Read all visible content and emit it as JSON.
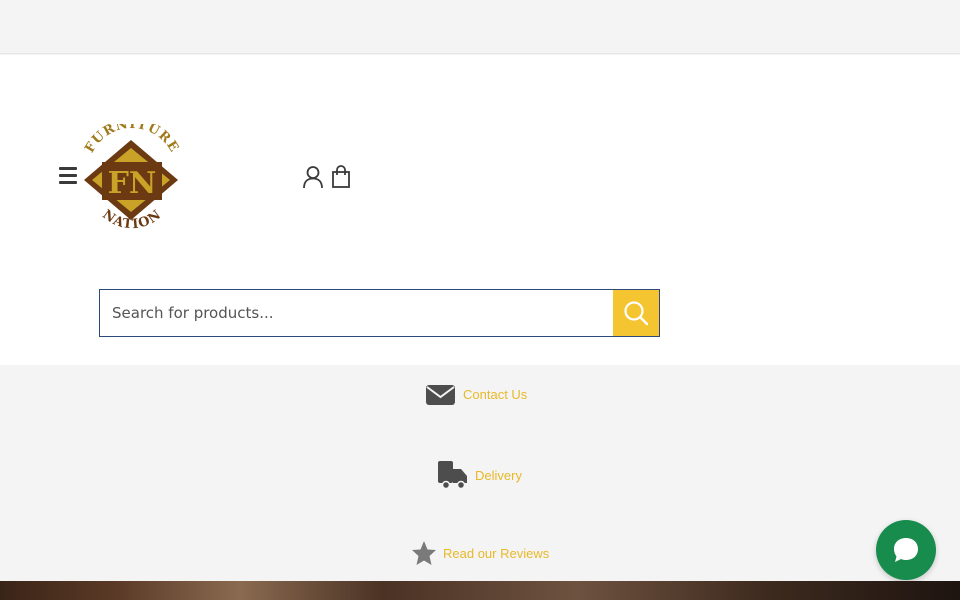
{
  "brand": {
    "logo_top_text": "FURNITURE",
    "logo_monogram": "FN",
    "logo_bottom_text": "NATION",
    "colors": {
      "gold": "#c9a227",
      "brown": "#6b3a12",
      "accent_yellow": "#f5c431",
      "chat_green": "#178c4d"
    }
  },
  "header": {
    "menu_icon": "hamburger-icon",
    "account_icon": "user-icon",
    "cart_icon": "shopping-bag-icon"
  },
  "search": {
    "placeholder": "Search for products...",
    "value": "",
    "button_icon": "search-icon"
  },
  "links": {
    "contact": {
      "label": "Contact Us",
      "icon": "envelope-icon"
    },
    "delivery": {
      "label": "Delivery",
      "icon": "truck-icon"
    },
    "reviews": {
      "label": "Read our Reviews",
      "icon": "star-icon"
    }
  },
  "chat": {
    "icon": "chat-bubble-icon"
  }
}
